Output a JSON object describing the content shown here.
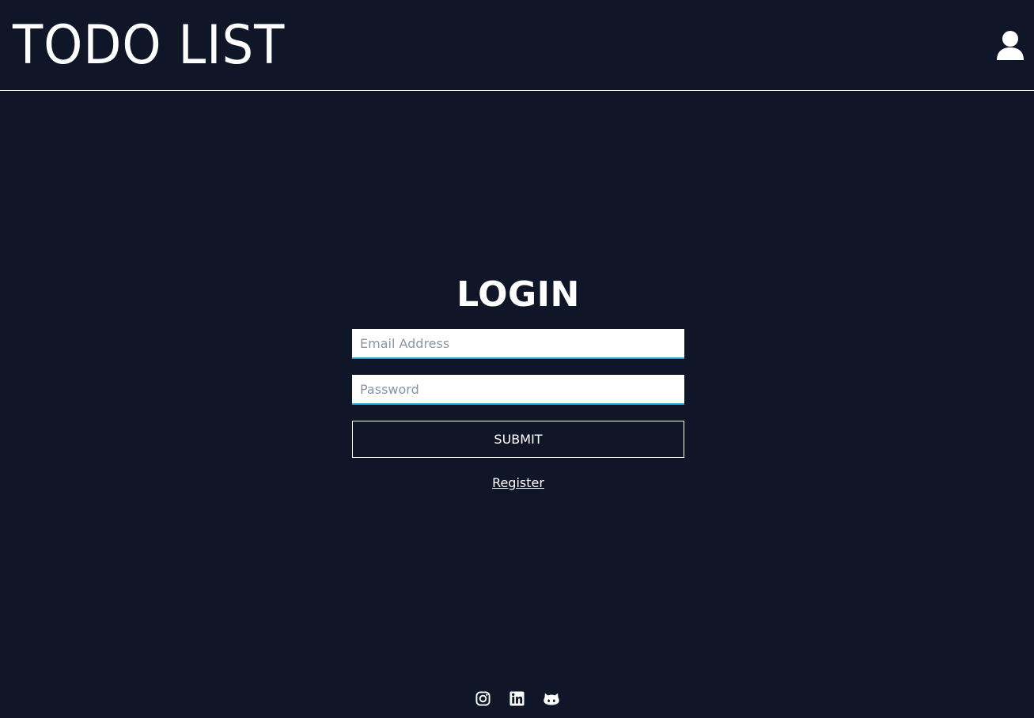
{
  "header": {
    "title": "TODO LIST",
    "user_icon": "user-icon"
  },
  "login": {
    "title": "LOGIN",
    "email": {
      "placeholder": "Email Address",
      "value": ""
    },
    "password": {
      "placeholder": "Password",
      "value": ""
    },
    "submit_label": "SUBMIT",
    "register_label": "Register"
  },
  "footer": {
    "icons": [
      "instagram-icon",
      "linkedin-icon",
      "github-icon"
    ]
  },
  "colors": {
    "background": "#0e1628",
    "text": "#ffffff",
    "input_accent": "#1aa3c8"
  }
}
